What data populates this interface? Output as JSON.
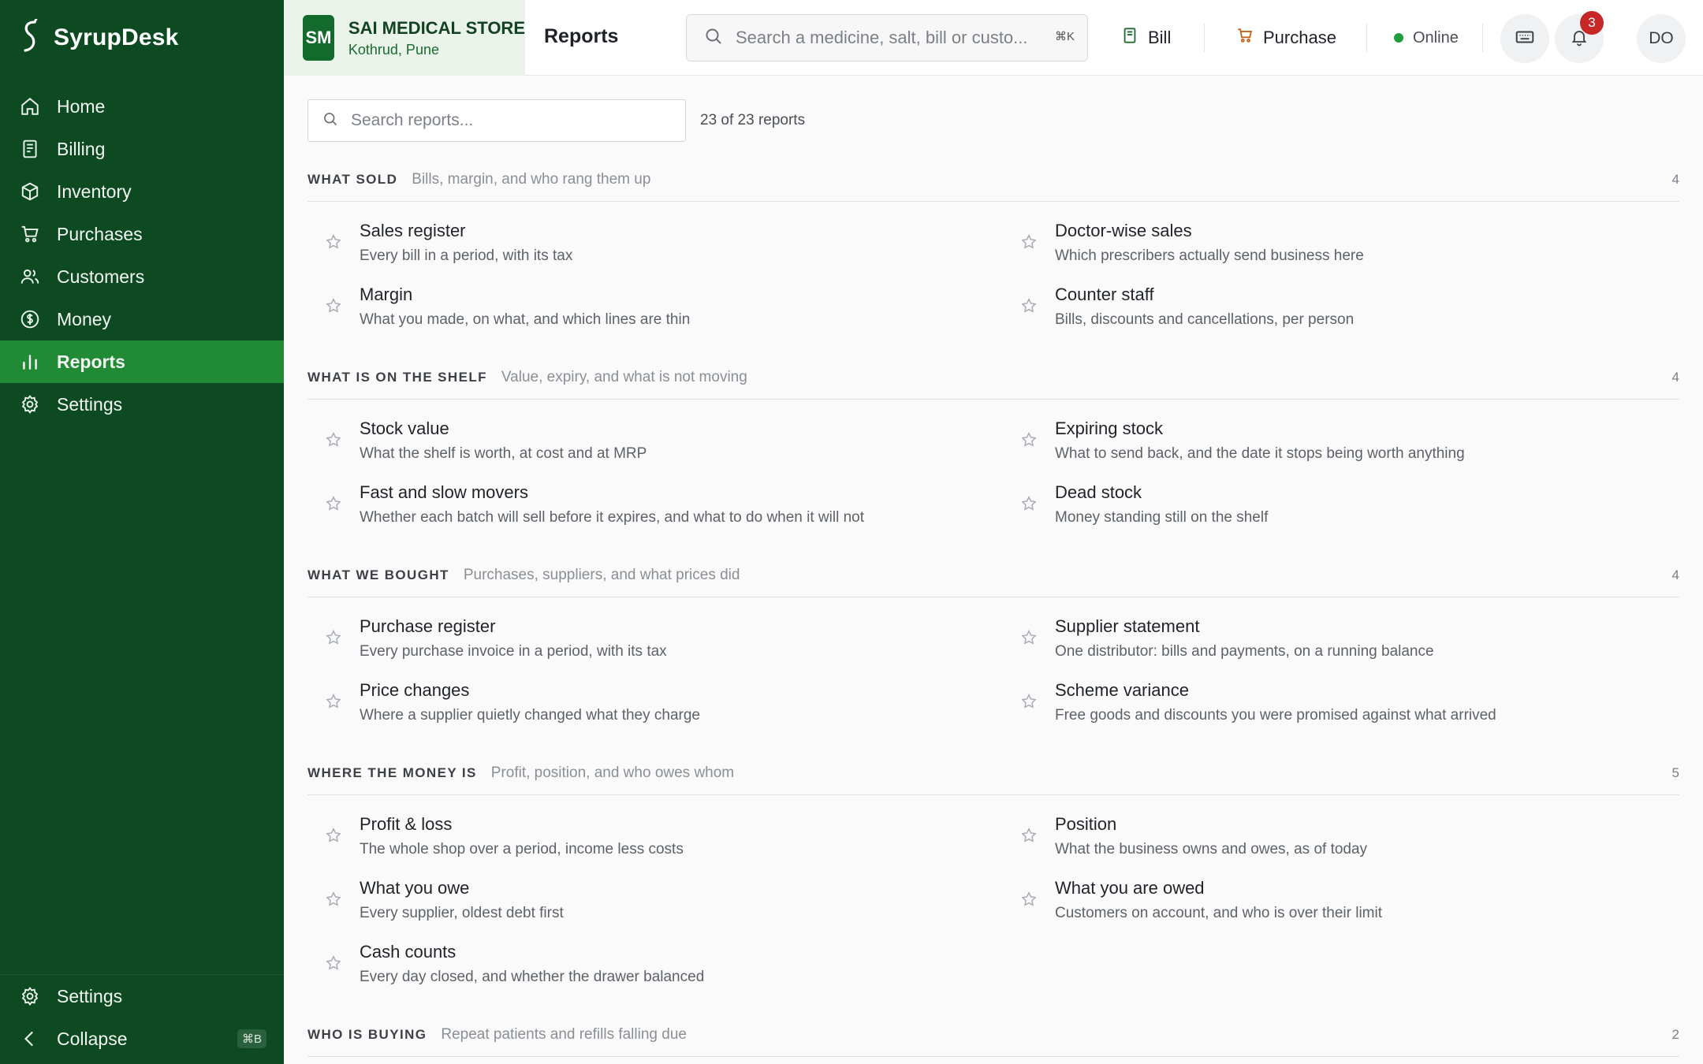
{
  "app": {
    "name": "SyrupDesk"
  },
  "sidebar": {
    "items": [
      {
        "label": "Home",
        "icon": "home-icon"
      },
      {
        "label": "Billing",
        "icon": "receipt-icon"
      },
      {
        "label": "Inventory",
        "icon": "box-icon"
      },
      {
        "label": "Purchases",
        "icon": "cart-icon"
      },
      {
        "label": "Customers",
        "icon": "users-icon"
      },
      {
        "label": "Money",
        "icon": "money-icon"
      },
      {
        "label": "Reports",
        "icon": "bar-chart-icon",
        "active": true
      },
      {
        "label": "Settings",
        "icon": "gear-icon"
      }
    ],
    "bottom": {
      "settings_label": "Settings",
      "collapse_label": "Collapse",
      "collapse_shortcut": "⌘B"
    }
  },
  "header": {
    "store_initials": "SM",
    "store_name": "SAI MEDICAL STORE",
    "store_location": "Kothrud, Pune",
    "page_title": "Reports",
    "search_placeholder": "Search a medicine, salt, bill or custo...",
    "search_shortcut": "⌘K",
    "bill_label": "Bill",
    "purchase_label": "Purchase",
    "status_label": "Online",
    "notification_count": "3",
    "user_initials": "DO"
  },
  "reports": {
    "search_placeholder": "Search reports...",
    "count_text": "23 of 23 reports",
    "sections": [
      {
        "title": "WHAT SOLD",
        "subtitle": "Bills, margin, and who rang them up",
        "count": "4",
        "items": [
          {
            "title": "Sales register",
            "desc": "Every bill in a period, with its tax"
          },
          {
            "title": "Doctor-wise sales",
            "desc": "Which prescribers actually send business here"
          },
          {
            "title": "Margin",
            "desc": "What you made, on what, and which lines are thin"
          },
          {
            "title": "Counter staff",
            "desc": "Bills, discounts and cancellations, per person"
          }
        ]
      },
      {
        "title": "WHAT IS ON THE SHELF",
        "subtitle": "Value, expiry, and what is not moving",
        "count": "4",
        "items": [
          {
            "title": "Stock value",
            "desc": "What the shelf is worth, at cost and at MRP"
          },
          {
            "title": "Expiring stock",
            "desc": "What to send back, and the date it stops being worth anything"
          },
          {
            "title": "Fast and slow movers",
            "desc": "Whether each batch will sell before it expires, and what to do when it will not"
          },
          {
            "title": "Dead stock",
            "desc": "Money standing still on the shelf"
          }
        ]
      },
      {
        "title": "WHAT WE BOUGHT",
        "subtitle": "Purchases, suppliers, and what prices did",
        "count": "4",
        "items": [
          {
            "title": "Purchase register",
            "desc": "Every purchase invoice in a period, with its tax"
          },
          {
            "title": "Supplier statement",
            "desc": "One distributor: bills and payments, on a running balance"
          },
          {
            "title": "Price changes",
            "desc": "Where a supplier quietly changed what they charge"
          },
          {
            "title": "Scheme variance",
            "desc": "Free goods and discounts you were promised against what arrived"
          }
        ]
      },
      {
        "title": "WHERE THE MONEY IS",
        "subtitle": "Profit, position, and who owes whom",
        "count": "5",
        "items": [
          {
            "title": "Profit & loss",
            "desc": "The whole shop over a period, income less costs"
          },
          {
            "title": "Position",
            "desc": "What the business owns and owes, as of today"
          },
          {
            "title": "What you owe",
            "desc": "Every supplier, oldest debt first"
          },
          {
            "title": "What you are owed",
            "desc": "Customers on account, and who is over their limit"
          },
          {
            "title": "Cash counts",
            "desc": "Every day closed, and whether the drawer balanced"
          }
        ]
      },
      {
        "title": "WHO IS BUYING",
        "subtitle": "Repeat patients and refills falling due",
        "count": "2",
        "items": []
      }
    ]
  },
  "colors": {
    "sidebar_bg": "#0d4a22",
    "sidebar_active": "#218a34",
    "accent_green": "#126b2c",
    "notification_red": "#c62828",
    "online_green": "#1e9e3c"
  }
}
